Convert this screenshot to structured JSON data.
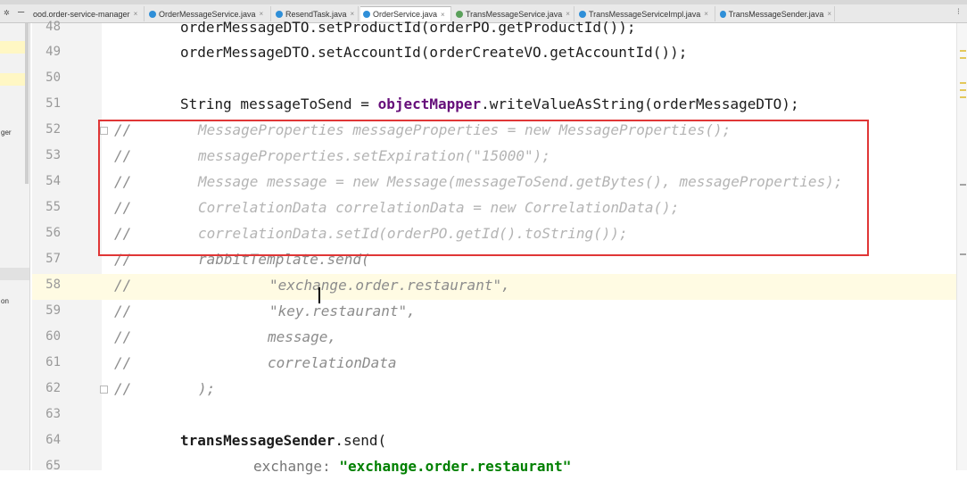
{
  "tabs": [
    {
      "label": "ood.order-service-manager",
      "icon_color": "#5a78b0",
      "active": false
    },
    {
      "label": "OrderMessageService.java",
      "icon_color": "#2f8fd8",
      "active": false
    },
    {
      "label": "ResendTask.java",
      "icon_color": "#2f8fd8",
      "active": false
    },
    {
      "label": "OrderService.java",
      "icon_color": "#2f8fd8",
      "active": true
    },
    {
      "label": "TransMessageService.java",
      "icon_color": "#5aa05a",
      "active": false
    },
    {
      "label": "TransMessageServiceImpl.java",
      "icon_color": "#2f8fd8",
      "active": false
    },
    {
      "label": "TransMessageSender.java",
      "icon_color": "#2f8fd8",
      "active": false
    }
  ],
  "icons": {
    "gear": "gear-icon",
    "close": "close-icon"
  },
  "left_panel": {
    "item_ger": "ger",
    "item_on": "on"
  },
  "lines": [
    {
      "num": "48",
      "text": "orderMessageDTO.setProductId(orderPO.getProductId());"
    },
    {
      "num": "49",
      "text": "orderMessageDTO.setAccountId(orderCreateVO.getAccountId());"
    },
    {
      "num": "50",
      "text": ""
    },
    {
      "num": "51",
      "pre": "String messageToSend = ",
      "field": "objectMapper",
      "post": ".writeValueAsString(orderMessageDTO);"
    },
    {
      "num": "52",
      "comment": "//",
      "text": "MessageProperties messageProperties = new MessageProperties();"
    },
    {
      "num": "53",
      "comment": "//",
      "text": "messageProperties.setExpiration(\"15000\");"
    },
    {
      "num": "54",
      "comment": "//",
      "text": "Message message = new Message(messageToSend.getBytes(), messageProperties);"
    },
    {
      "num": "55",
      "comment": "//",
      "text": "CorrelationData correlationData = new CorrelationData();"
    },
    {
      "num": "56",
      "comment": "//",
      "text": "correlationData.setId(orderPO.getId().toString());"
    },
    {
      "num": "57",
      "comment": "//",
      "text": "rabbitTemplate.send("
    },
    {
      "num": "58",
      "comment": "//",
      "text": "\"exchange.order.restaurant\","
    },
    {
      "num": "59",
      "comment": "//",
      "text": "\"key.restaurant\","
    },
    {
      "num": "60",
      "comment": "//",
      "text": "message,"
    },
    {
      "num": "61",
      "comment": "//",
      "text": "correlationData"
    },
    {
      "num": "62",
      "comment": "//",
      "text": ");"
    },
    {
      "num": "63",
      "text": ""
    },
    {
      "num": "64",
      "bold": "transMessageSender",
      "post": ".send("
    },
    {
      "num": "65",
      "param": "exchange: ",
      "str": "\"exchange.order.restaurant\""
    }
  ],
  "colors": {
    "highlight_box": "#e03636",
    "current_line": "#fffbe3",
    "comment": "#8c8c8c",
    "field": "#660e7a",
    "string": "#008000"
  }
}
